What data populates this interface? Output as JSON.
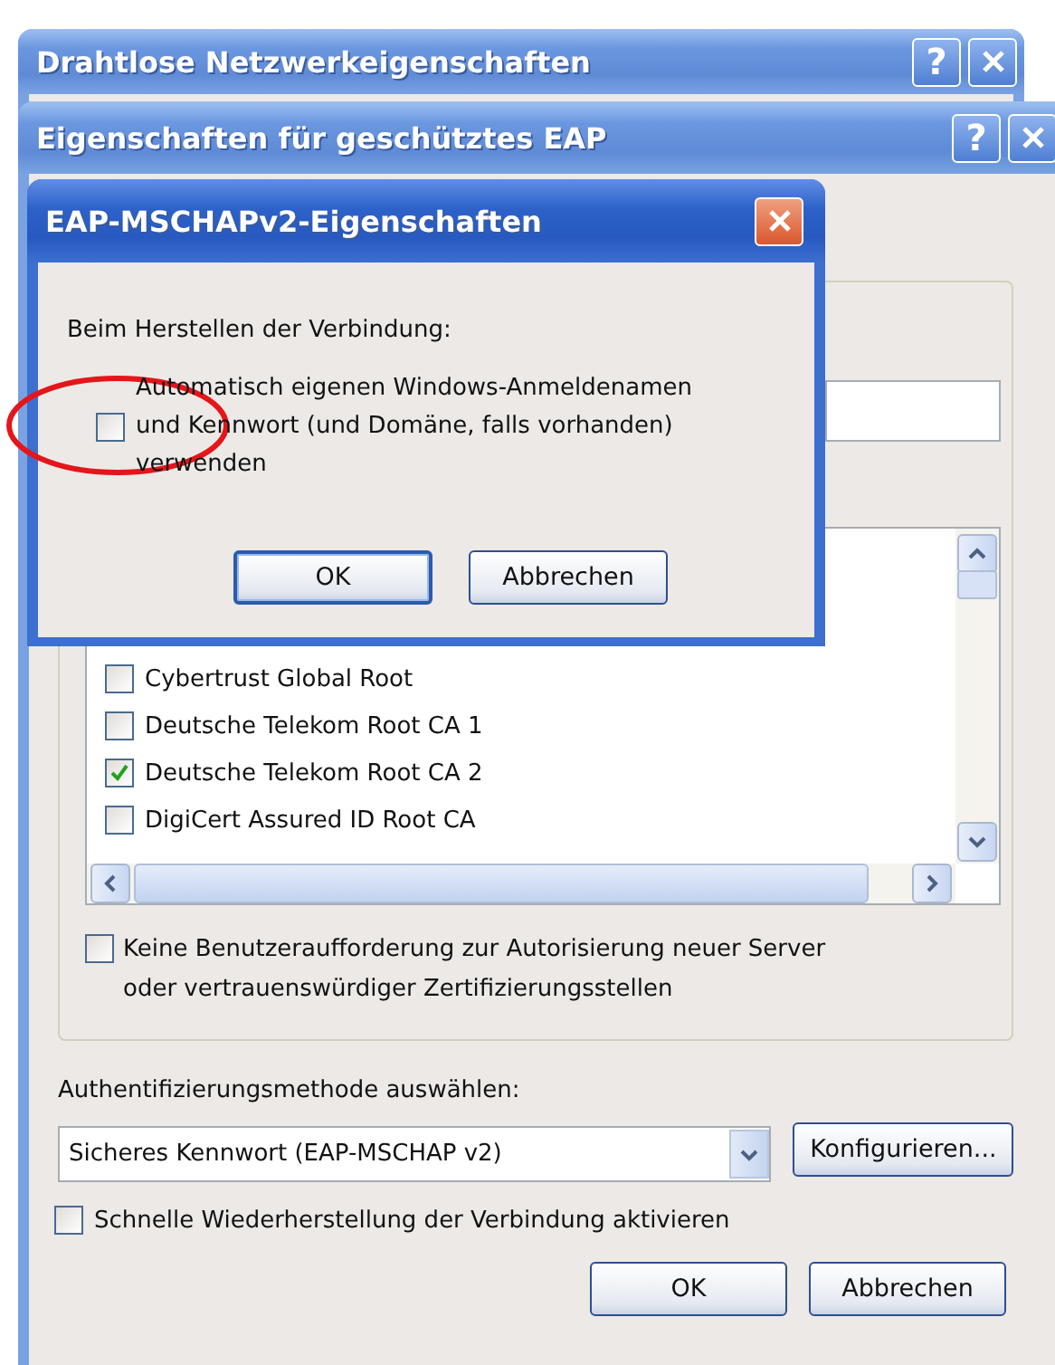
{
  "network_window": {
    "title": "Drahtlose Netzwerkeigenschaften",
    "help_button": "?"
  },
  "peap_window": {
    "title": "Eigenschaften für geschütztes EAP",
    "help_button": "?",
    "certificates": [
      {
        "label": "Cybertrust Global Root",
        "checked": false
      },
      {
        "label": "Deutsche Telekom Root CA 1",
        "checked": false
      },
      {
        "label": "Deutsche Telekom Root CA 2",
        "checked": true
      },
      {
        "label": "DigiCert Assured ID Root CA",
        "checked": false
      }
    ],
    "no_prompt": {
      "label": "Keine Benutzeraufforderung zur Autorisierung neuer Server\noder vertrauenswürdiger Zertifizierungsstellen",
      "checked": false
    },
    "method_label": "Authentifizierungsmethode auswählen:",
    "method_value": "Sicheres Kennwort (EAP-MSCHAP v2)",
    "configure_button": "Konfigurieren...",
    "fast_reconnect": {
      "label": "Schnelle Wiederherstellung der Verbindung aktivieren",
      "checked": false
    },
    "buttons": [
      "OK",
      "Abbrechen"
    ]
  },
  "mschap_dialog": {
    "title": "EAP-MSCHAPv2-Eigenschaften",
    "heading": "Beim Herstellen der Verbindung:",
    "auto_logon": {
      "label": "Automatisch eigenen Windows-Anmeldenamen\nund Kennwort (und Domäne, falls vorhanden)\nverwenden",
      "checked": false
    },
    "buttons": [
      {
        "label": "OK",
        "default": true
      },
      {
        "label": "Abbrechen",
        "default": false
      }
    ]
  }
}
